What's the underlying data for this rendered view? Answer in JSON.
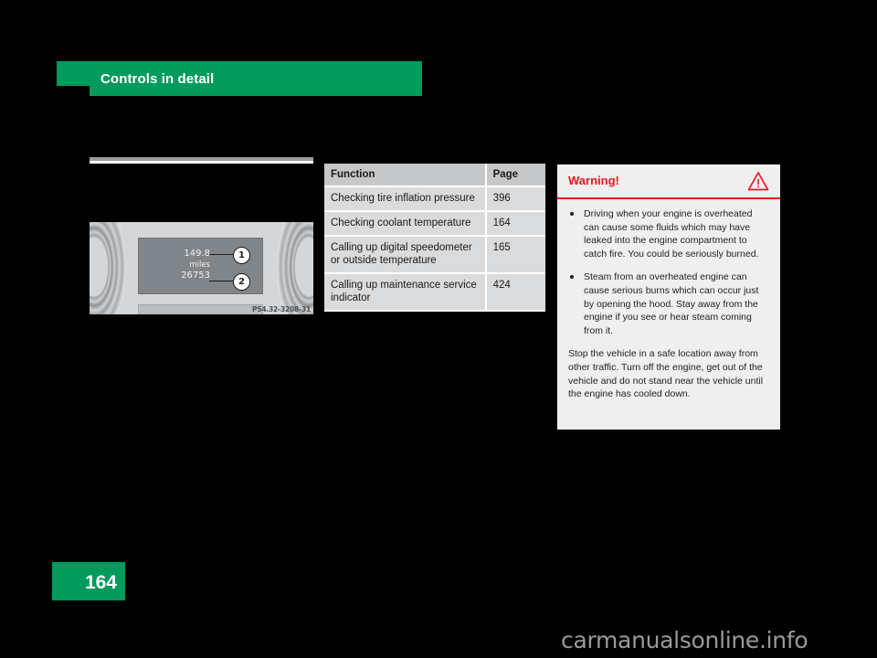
{
  "header": {
    "chapter_title": "Controls in detail",
    "bar_color": "#009b5c"
  },
  "figure": {
    "odometer_trip": "149.8",
    "odometer_unit": "miles",
    "odometer_total": "26753",
    "callout_1": "1",
    "callout_2": "2",
    "figure_code": "P54.32-3208-31"
  },
  "table": {
    "headers": {
      "function": "Function",
      "page": "Page"
    },
    "rows": [
      {
        "function": "Checking tire inflation pressure",
        "page": "396"
      },
      {
        "function": "Checking coolant temperature",
        "page": "164"
      },
      {
        "function": "Calling up digital speedometer or outside temperature",
        "page": "165"
      },
      {
        "function": "Calling up maintenance service indicator",
        "page": "424"
      }
    ]
  },
  "warning": {
    "title": "Warning!",
    "icon": "warning-triangle-icon",
    "accent_color": "#e8161d",
    "bullets": [
      "Driving when your engine is overheated can cause some fluids which may have leaked into the engine compartment to catch fire. You could be seriously burned.",
      "Steam from an overheated engine can cause serious burns which can occur just by opening the hood. Stay away from the engine if you see or hear steam coming from it."
    ],
    "paragraph": "Stop the vehicle in a safe location away from other traffic. Turn off the engine, get out of the vehicle and do not stand near the vehicle until the engine has cooled down."
  },
  "footer": {
    "page_number": "164",
    "watermark": "carmanualsonline.info"
  }
}
